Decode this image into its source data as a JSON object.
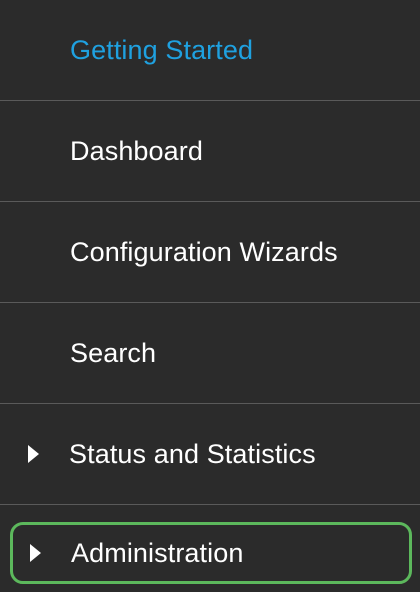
{
  "sidebar": {
    "items": [
      {
        "label": "Getting Started",
        "active": true,
        "expandable": false
      },
      {
        "label": "Dashboard",
        "expandable": false
      },
      {
        "label": "Configuration Wizards",
        "expandable": false
      },
      {
        "label": "Search",
        "expandable": false
      },
      {
        "label": "Status and Statistics",
        "expandable": true,
        "icon": "caret-right-icon"
      },
      {
        "label": "Administration",
        "expandable": true,
        "icon": "caret-right-icon",
        "highlighted": true
      }
    ],
    "colors": {
      "background": "#2b2b2b",
      "active_text": "#1fa1e0",
      "text": "#ffffff",
      "highlight_border": "#5cb85c",
      "divider": "#5a5a5a"
    }
  }
}
